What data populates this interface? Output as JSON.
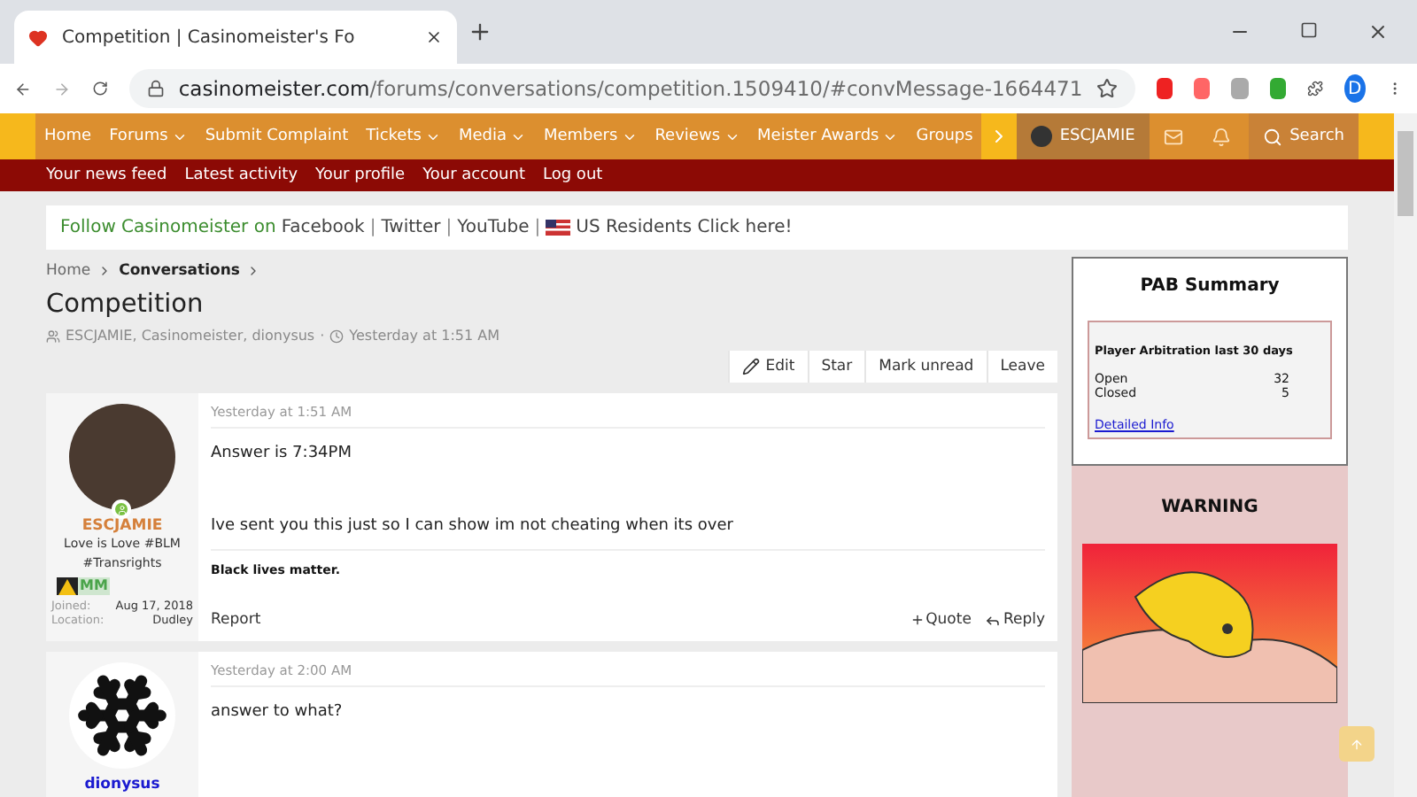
{
  "browser": {
    "tab_title": "Competition | Casinomeister's Fo",
    "url_host": "casinomeister.com",
    "url_path": "/forums/conversations/competition.1509410/#convMessage-1664471",
    "profile_letter": "D"
  },
  "nav": {
    "items": [
      {
        "label": "Home",
        "dropdown": false
      },
      {
        "label": "Forums",
        "dropdown": true
      },
      {
        "label": "Submit Complaint",
        "dropdown": false
      },
      {
        "label": "Tickets",
        "dropdown": true
      },
      {
        "label": "Media",
        "dropdown": true
      },
      {
        "label": "Members",
        "dropdown": true
      },
      {
        "label": "Reviews",
        "dropdown": true
      },
      {
        "label": "Meister Awards",
        "dropdown": true
      },
      {
        "label": "Groups",
        "dropdown": false
      }
    ],
    "user": "ESCJAMIE",
    "search": "Search"
  },
  "subnav": [
    "Your news feed",
    "Latest activity",
    "Your profile",
    "Your account",
    "Log out"
  ],
  "follow": {
    "prefix": "Follow Casinomeister on",
    "links": [
      "Facebook",
      "Twitter",
      "YouTube"
    ],
    "us_link": "US Residents Click here!",
    "separator": "|"
  },
  "breadcrumb": [
    {
      "label": "Home",
      "current": false
    },
    {
      "label": "Conversations",
      "current": true
    }
  ],
  "title": "Competition",
  "meta": {
    "participants": "ESCJAMIE, Casinomeister, dionysus",
    "time": "Yesterday at 1:51 AM",
    "separator": "·"
  },
  "actions": [
    {
      "label": "Edit",
      "kind": "edit"
    },
    {
      "label": "Star",
      "kind": "plain"
    },
    {
      "label": "Mark unread",
      "kind": "plain"
    },
    {
      "label": "Leave",
      "kind": "plain"
    }
  ],
  "posts": [
    {
      "author": "ESCJAMIE",
      "color": "#d5803b",
      "kind": "photo",
      "online": true,
      "tagline": "Love is Love #BLM #Transrights",
      "badge": "MM",
      "stats": [
        {
          "label": "Joined:",
          "value": "Aug 17, 2018"
        },
        {
          "label": "Location:",
          "value": "Dudley"
        }
      ],
      "time": "Yesterday at 1:51 AM",
      "body": [
        "Answer is 7:34PM",
        "Ive sent you this just so I can show im not cheating when its over"
      ],
      "signature": "Black lives matter.",
      "report": "Report",
      "quote": "Quote",
      "reply": "Reply"
    },
    {
      "author": "dionysus",
      "color": "#1a1ad0",
      "kind": "snowflake",
      "online": false,
      "time": "Yesterday at 2:00 AM",
      "body": [
        "answer to what?"
      ]
    }
  ],
  "sidebar": {
    "pab": {
      "title": "PAB Summary",
      "subtitle": "Player Arbitration last 30 days",
      "rows": [
        {
          "label": "Open",
          "value": "32"
        },
        {
          "label": "Closed",
          "value": "5"
        }
      ],
      "link": "Detailed Info"
    },
    "warning": {
      "title": "WARNING"
    }
  }
}
